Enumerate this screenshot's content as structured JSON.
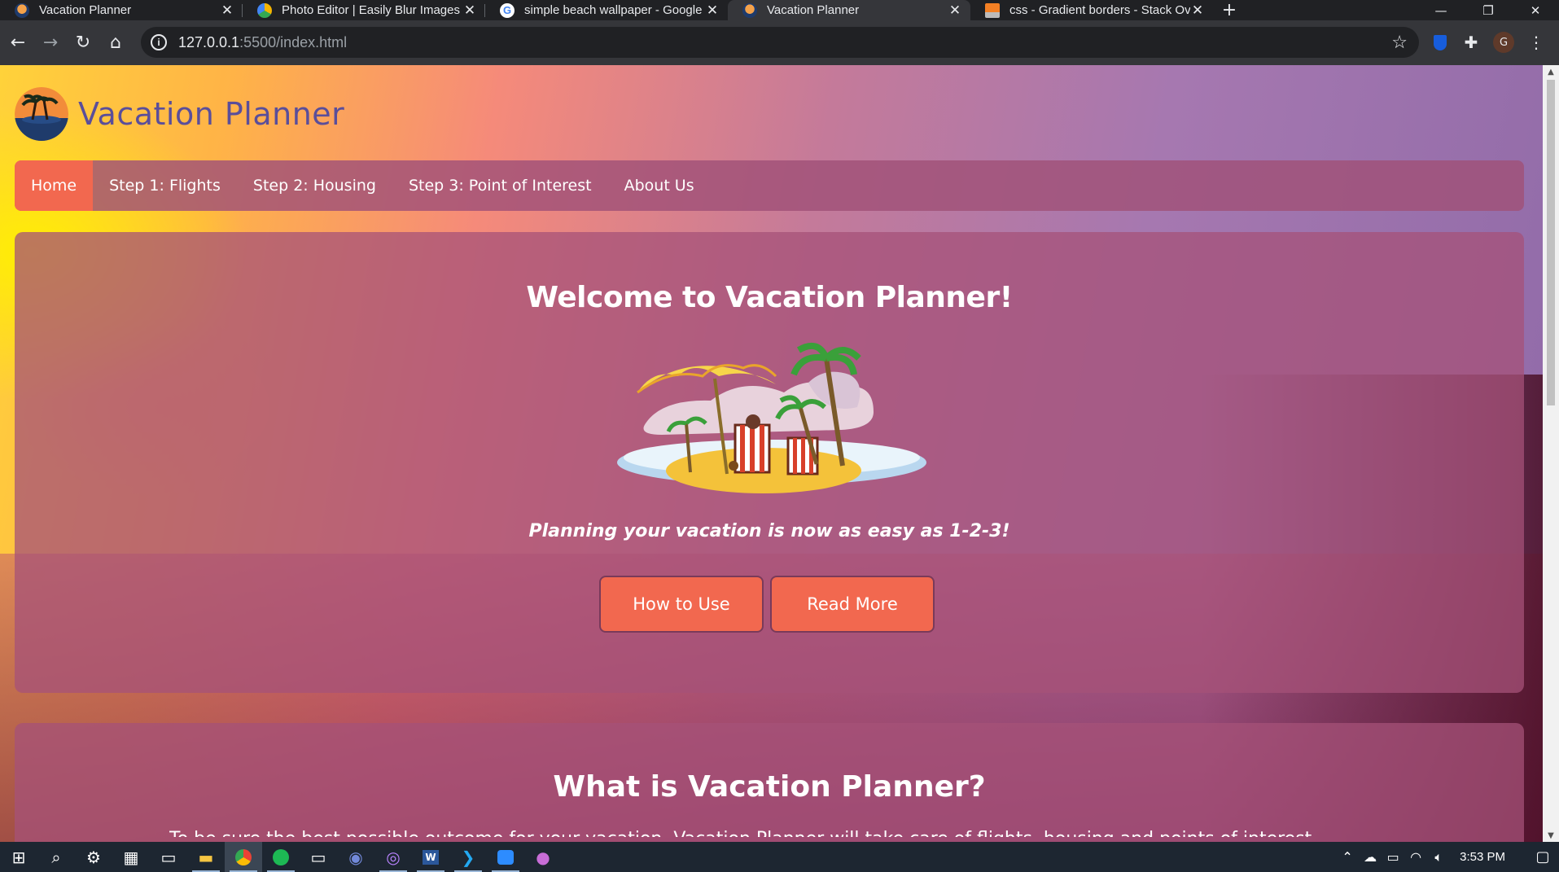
{
  "browser": {
    "tabs": [
      {
        "title": "Vacation Planner",
        "active": false
      },
      {
        "title": "Photo Editor | Easily Blur Images",
        "active": false
      },
      {
        "title": "simple beach wallpaper - Google",
        "active": false
      },
      {
        "title": "Vacation Planner",
        "active": true
      },
      {
        "title": "css - Gradient borders - Stack Ov",
        "active": false
      }
    ],
    "new_tab": "+",
    "window_controls": {
      "minimize": "—",
      "restore": "❐",
      "close": "✕"
    },
    "address": {
      "host": "127.0.0.1",
      "path": ":5500/index.html"
    },
    "profile_initial": "G"
  },
  "site": {
    "brand": "Vacation  Planner",
    "nav": [
      {
        "label": "Home",
        "active": true
      },
      {
        "label": "Step 1:  Flights",
        "active": false
      },
      {
        "label": "Step 2:  Housing",
        "active": false
      },
      {
        "label": "Step 3:  Point of  Interest",
        "active": false
      },
      {
        "label": "About Us",
        "active": false
      }
    ],
    "hero": {
      "title": "Welcome to Vacation  Planner!",
      "tagline": "Planning your vacation is now as easy as 1-2-3!",
      "buttons": [
        "How to Use",
        "Read  More"
      ]
    },
    "section2": {
      "title": "What is Vacation  Planner?",
      "cut_text": "To be sure the best possible outcome for your vacation, Vacation Planner will take care of flights, housing and points of interest"
    }
  },
  "taskbar": {
    "clock": "3:53 PM"
  },
  "colors": {
    "accent": "#f2684f",
    "brand_text": "#5a4e9a",
    "panel": "#a55278"
  }
}
